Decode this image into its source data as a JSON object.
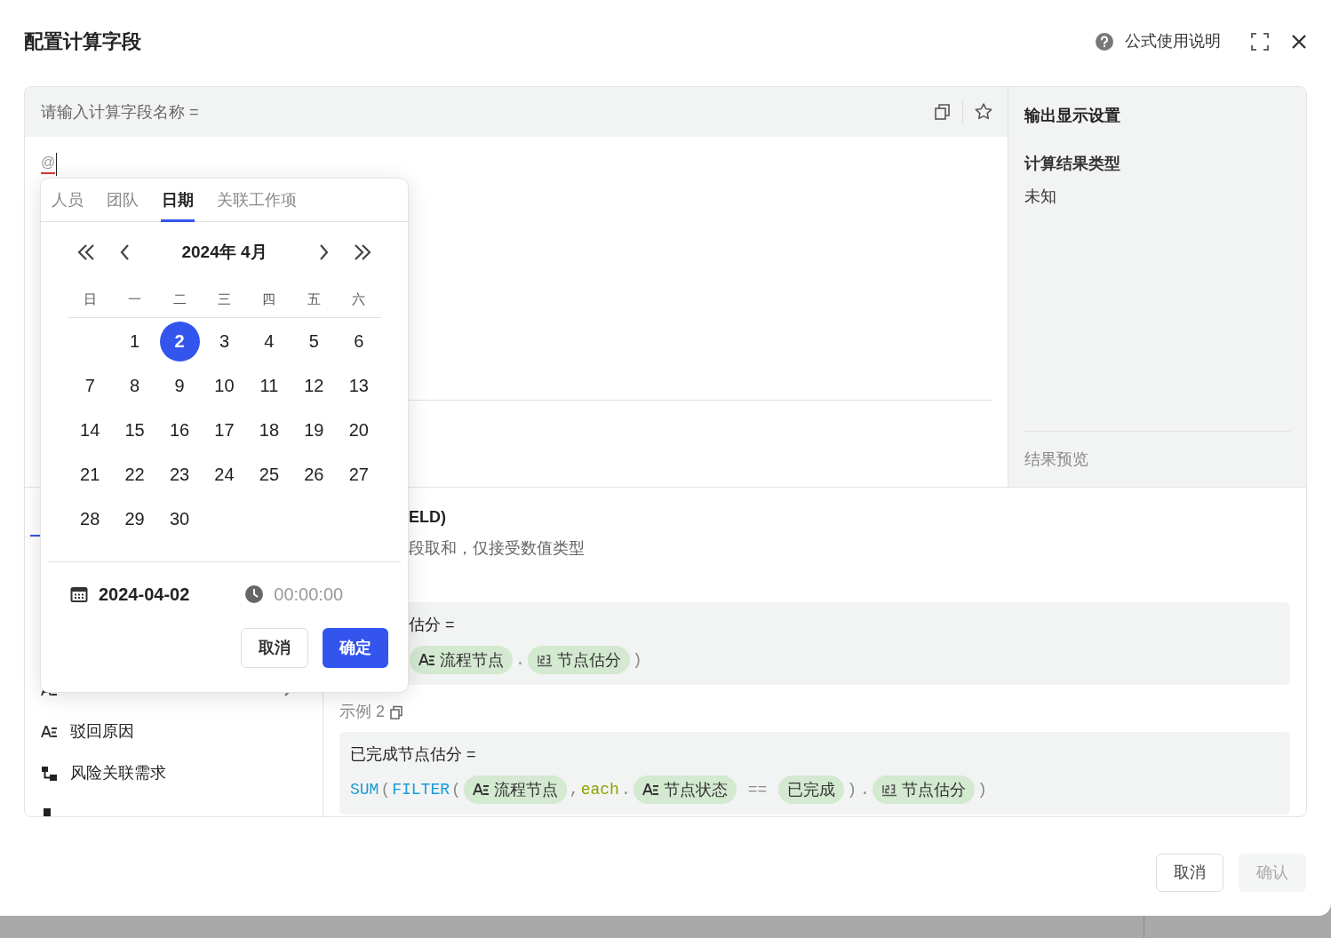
{
  "dialog": {
    "title": "配置计算字段",
    "help_link": "公式使用说明"
  },
  "editor": {
    "name_placeholder": "请输入计算字段名称 =",
    "input_text": "@"
  },
  "output_settings": {
    "title": "输出显示设置",
    "result_type_label": "计算结果类型",
    "result_type_value": "未知",
    "preview_label": "结果预览"
  },
  "field_list": [
    {
      "kind": "text",
      "has_submenu": true
    },
    {
      "label": "驳回原因",
      "kind": "text",
      "has_submenu": false
    },
    {
      "label": "风险关联需求",
      "kind": "relation",
      "has_submenu": false
    },
    {
      "kind": "version",
      "has_submenu": false
    }
  ],
  "function_doc": {
    "title": "ELD)",
    "description": "段取和，仅接受数值类型",
    "examples": [
      {
        "name": "估分 =",
        "tokens": [
          {
            "kind": "text_chip",
            "text": "流程节点"
          },
          {
            "kind": "punct",
            "text": "."
          },
          {
            "kind": "number_chip",
            "text": "节点估分"
          },
          {
            "kind": "punct",
            "text": ")"
          }
        ]
      },
      {
        "label": "示例 2",
        "name": "已完成节点估分 =",
        "tokens": [
          {
            "kind": "function",
            "text": "SUM"
          },
          {
            "kind": "punct",
            "text": "("
          },
          {
            "kind": "function",
            "text": "FILTER"
          },
          {
            "kind": "punct",
            "text": "("
          },
          {
            "kind": "text_chip",
            "text": "流程节点"
          },
          {
            "kind": "punct",
            "text": ","
          },
          {
            "kind": "keyword",
            "text": "each"
          },
          {
            "kind": "punct",
            "text": "."
          },
          {
            "kind": "text_chip",
            "text": "节点状态"
          },
          {
            "kind": "operator",
            "text": "=="
          },
          {
            "kind": "value_chip",
            "text": "已完成"
          },
          {
            "kind": "punct",
            "text": ")"
          },
          {
            "kind": "punct",
            "text": "."
          },
          {
            "kind": "number_chip",
            "text": "节点估分"
          },
          {
            "kind": "punct",
            "text": ")"
          }
        ]
      }
    ]
  },
  "date_picker": {
    "tabs": [
      {
        "label": "人员",
        "selected": false
      },
      {
        "label": "团队",
        "selected": false
      },
      {
        "label": "日期",
        "selected": true
      },
      {
        "label": "关联工作项",
        "selected": false
      }
    ],
    "month": "2024年 4月",
    "weekdays": [
      "日",
      "一",
      "二",
      "三",
      "四",
      "五",
      "六"
    ],
    "weeks": [
      [
        {
          "label": "1",
          "selected": false
        },
        {
          "label": "2",
          "selected": true
        },
        {
          "label": "3",
          "selected": false
        },
        {
          "label": "4",
          "selected": false
        },
        {
          "label": "5",
          "selected": false
        },
        {
          "label": "6",
          "selected": false
        }
      ],
      [
        {
          "label": "7",
          "selected": false
        },
        {
          "label": "8",
          "selected": false
        },
        {
          "label": "9",
          "selected": false
        },
        {
          "label": "10",
          "selected": false
        },
        {
          "label": "11",
          "selected": false
        },
        {
          "label": "12",
          "selected": false
        },
        {
          "label": "13",
          "selected": false
        }
      ],
      [
        {
          "label": "14",
          "selected": false
        },
        {
          "label": "15",
          "selected": false
        },
        {
          "label": "16",
          "selected": false
        },
        {
          "label": "17",
          "selected": false
        },
        {
          "label": "18",
          "selected": false
        },
        {
          "label": "19",
          "selected": false
        },
        {
          "label": "20",
          "selected": false
        }
      ],
      [
        {
          "label": "21",
          "selected": false
        },
        {
          "label": "22",
          "selected": false
        },
        {
          "label": "23",
          "selected": false
        },
        {
          "label": "24",
          "selected": false
        },
        {
          "label": "25",
          "selected": false
        },
        {
          "label": "26",
          "selected": false
        },
        {
          "label": "27",
          "selected": false
        }
      ],
      [
        {
          "label": "28",
          "selected": false
        },
        {
          "label": "29",
          "selected": false
        },
        {
          "label": "30",
          "selected": false
        }
      ]
    ],
    "date_value": "2024-04-02",
    "time_value": "00:00:00",
    "cancel": "取消",
    "ok": "确定"
  },
  "footer": {
    "cancel": "取消",
    "confirm": {
      "label": "确认",
      "disabled": true
    }
  }
}
